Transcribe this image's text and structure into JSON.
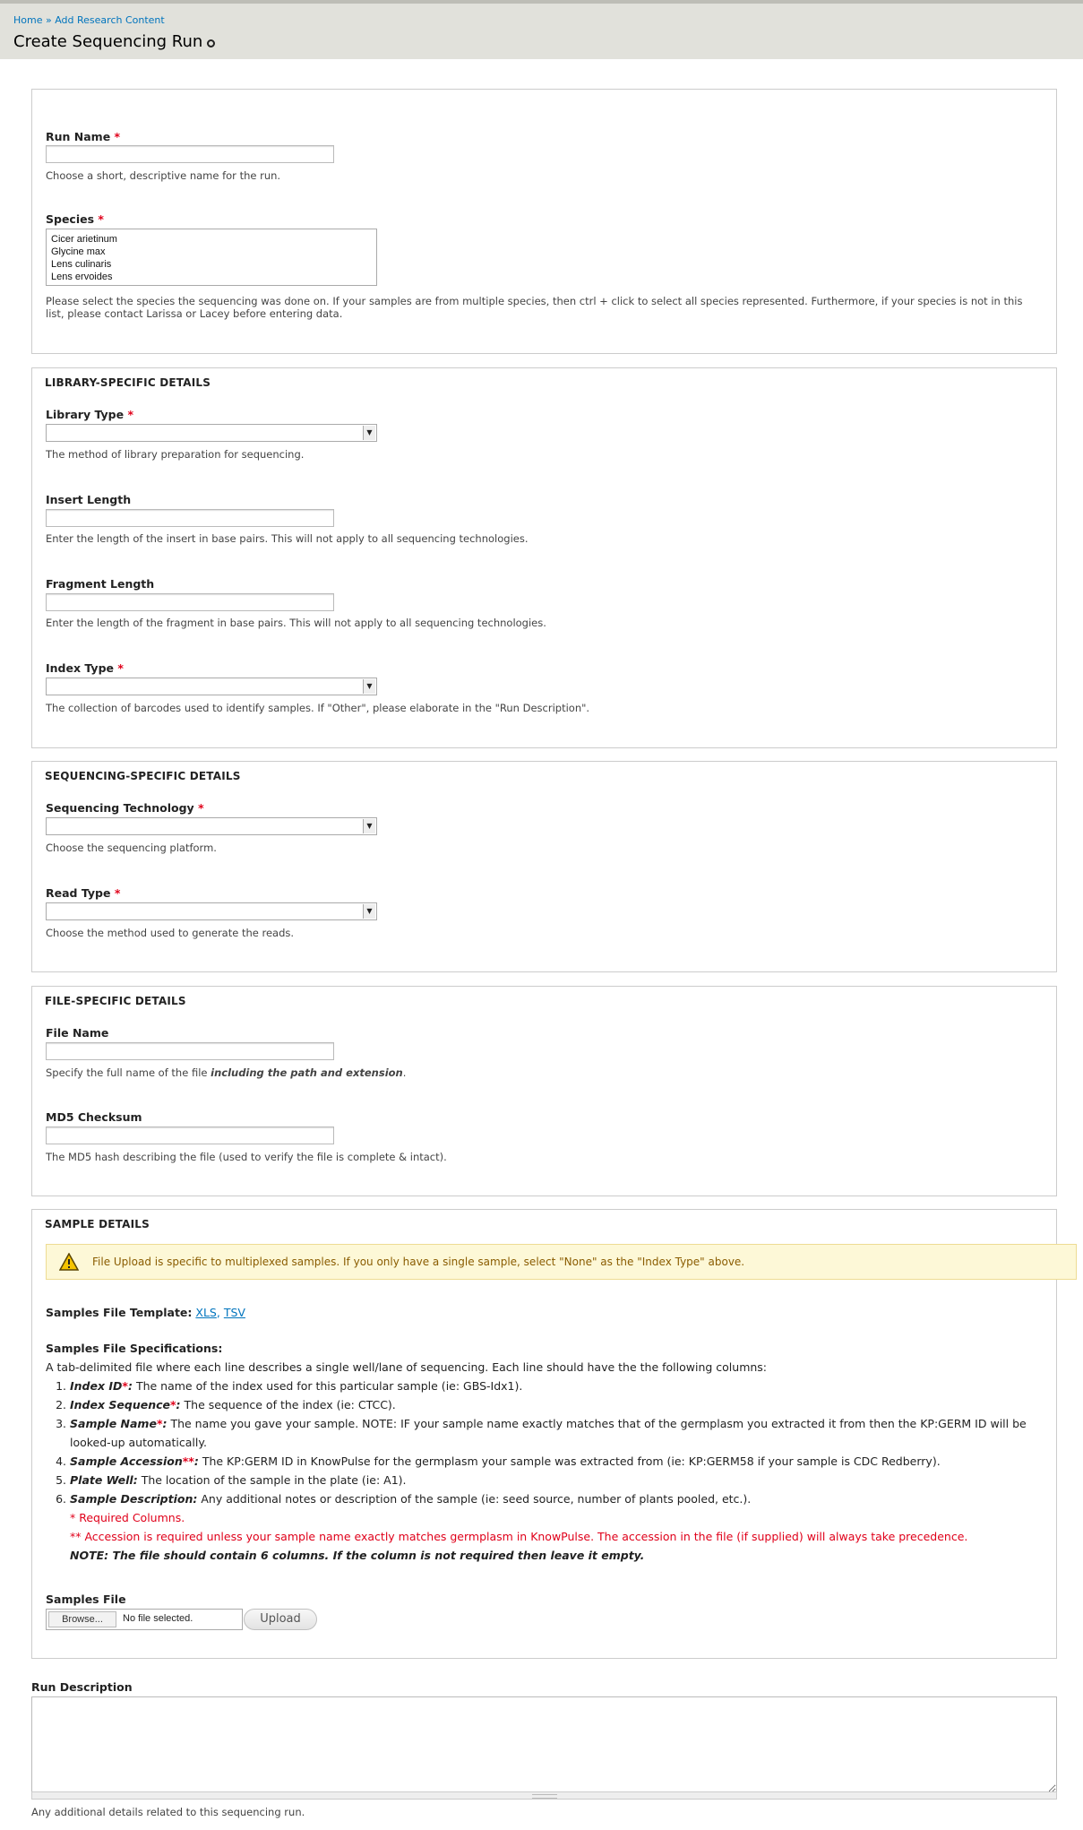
{
  "breadcrumb": {
    "home": "Home",
    "separator": "»",
    "current": "Add Research Content"
  },
  "page": {
    "title": "Create Sequencing Run"
  },
  "required_marker": "*",
  "basic": {
    "run_name_label": "Run Name",
    "run_name_value": "",
    "run_name_desc": "Choose a short, descriptive name for the run.",
    "species_label": "Species",
    "species_options": [
      "Cicer arietinum",
      "Glycine max",
      "Lens culinaris",
      "Lens ervoides"
    ],
    "species_desc_1": "Please select the species the sequencing was done on. If your samples are from multiple species, then ctrl + click to select all species represented. Furthermore, if your species is not in this",
    "species_desc_2": "list, please contact Larissa or Lacey before entering data."
  },
  "library": {
    "legend": "LIBRARY-SPECIFIC DETAILS",
    "library_type_label": "Library Type",
    "library_type_value": "",
    "library_type_desc": "The method of library preparation for sequencing.",
    "insert_length_label": "Insert Length",
    "insert_length_value": "",
    "insert_length_desc": "Enter the length of the insert in base pairs. This will not apply to all sequencing technologies.",
    "fragment_length_label": "Fragment Length",
    "fragment_length_value": "",
    "fragment_length_desc": "Enter the length of the fragment in base pairs. This will not apply to all sequencing technologies.",
    "index_type_label": "Index Type",
    "index_type_value": "",
    "index_type_desc": "The collection of barcodes used to identify samples. If \"Other\", please elaborate in the \"Run Description\"."
  },
  "sequencing": {
    "legend": "SEQUENCING-SPECIFIC DETAILS",
    "technology_label": "Sequencing Technology",
    "technology_value": "",
    "technology_desc": "Choose the sequencing platform.",
    "read_type_label": "Read Type",
    "read_type_value": "",
    "read_type_desc": "Choose the method used to generate the reads."
  },
  "file": {
    "legend": "FILE-SPECIFIC DETAILS",
    "file_name_label": "File Name",
    "file_name_value": "",
    "file_name_desc_prefix": "Specify the full name of the file ",
    "file_name_desc_emphasis": "including the path and extension",
    "file_name_desc_suffix": ".",
    "md5_label": "MD5 Checksum",
    "md5_value": "",
    "md5_desc": "The MD5 hash describing the file (used to verify the file is complete & intact)."
  },
  "sample": {
    "legend": "SAMPLE DETAILS",
    "warning_icon": "warning-triangle-icon",
    "warning": "File Upload is specific to multiplexed samples. If you only have a single sample, select \"None\" as the \"Index Type\" above.",
    "template_label": "Samples File Template:",
    "template_xls": "XLS",
    "template_sep": ",",
    "template_tsv": "TSV",
    "spec_title": "Samples File Specifications:",
    "spec_intro": "A tab-delimited file where each line describes a single well/lane of sequencing. Each line should have the the following columns:",
    "columns": [
      {
        "name": "Index ID",
        "marker": "*",
        "sep": ":",
        "text": " The name of the index used for this particular sample (ie: GBS-Idx1)."
      },
      {
        "name": "Index Sequence",
        "marker": "*",
        "sep": ":",
        "text": " The sequence of the index (ie: CTCC)."
      },
      {
        "name": "Sample Name",
        "marker": "*",
        "sep": ":",
        "text": " The name you gave your sample. NOTE: IF your sample name exactly matches that of the germplasm you extracted it from then the KP:GERM ID will be looked-up automatically."
      },
      {
        "name": "Sample Accession",
        "marker": "**",
        "sep": ":",
        "text": " The KP:GERM ID in KnowPulse for the germplasm your sample was extracted from (ie: KP:GERM58 if your sample is CDC Redberry)."
      },
      {
        "name": "Plate Well",
        "marker": "",
        "sep": ":",
        "text": " The location of the sample in the plate (ie: A1)."
      },
      {
        "name": "Sample Description",
        "marker": "",
        "sep": ":",
        "text": " Any additional notes or description of the sample (ie: seed source, number of plants pooled, etc.)."
      }
    ],
    "required_note": "* Required Columns.",
    "accession_note": "** Accession is required unless your sample name exactly matches germplasm in KnowPulse. The accession in the file (if supplied) will always take precedence.",
    "columns_note": "NOTE: The file should contain 6 columns. If the column is not required then leave it empty.",
    "file_label": "Samples File",
    "browse_label": "Browse...",
    "no_file": "No file selected.",
    "upload_label": "Upload"
  },
  "run_description": {
    "label": "Run Description",
    "value": "",
    "desc": "Any additional details related to this sequencing run."
  }
}
